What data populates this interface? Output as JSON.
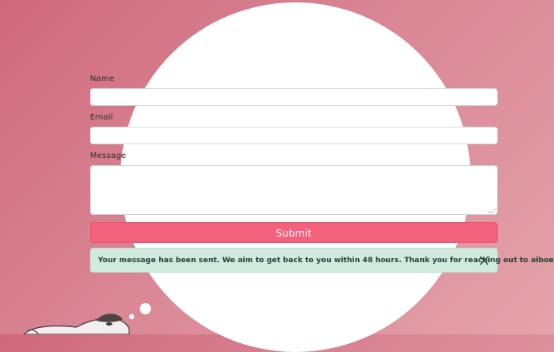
{
  "form": {
    "name_label": "Name",
    "email_label": "Email",
    "message_label": "Message",
    "name_value": "",
    "email_value": "",
    "message_value": "",
    "submit_label": "Submit"
  },
  "alert": {
    "text": "Your message has been sent. We aim to get back to you within 48 hours. Thank you for reaching out to aiboetc."
  },
  "colors": {
    "background": "#d98594",
    "submit": "#f2627d",
    "alert_bg": "#d1eadf"
  }
}
